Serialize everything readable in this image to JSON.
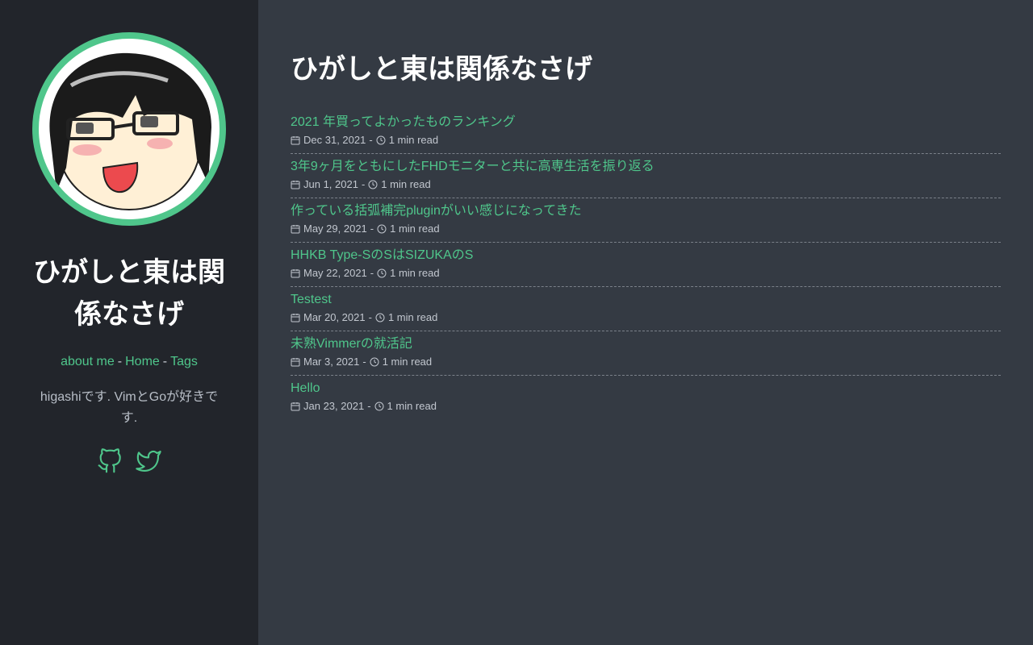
{
  "sidebar": {
    "title": "ひがしと東は関係なさげ",
    "nav": {
      "about": "about me",
      "home": "Home",
      "tags": "Tags",
      "separator": "-"
    },
    "bio": "higashiです. VimとGoが好きです.",
    "accent_color": "#4fc68b",
    "social_icons": [
      "github-icon",
      "twitter-icon"
    ]
  },
  "main": {
    "title": "ひがしと東は関係なさげ",
    "meta_separator": "-",
    "posts": [
      {
        "title": "2021 年買ってよかったものランキング",
        "date": "Dec 31, 2021",
        "read_time": "1 min read"
      },
      {
        "title": "3年9ヶ月をともにしたFHDモニターと共に高専生活を振り返る",
        "date": "Jun 1, 2021",
        "read_time": "1 min read"
      },
      {
        "title": "作っている括弧補完pluginがいい感じになってきた",
        "date": "May 29, 2021",
        "read_time": "1 min read"
      },
      {
        "title": "HHKB Type-SのSはSIZUKAのS",
        "date": "May 22, 2021",
        "read_time": "1 min read"
      },
      {
        "title": "Testest",
        "date": "Mar 20, 2021",
        "read_time": "1 min read"
      },
      {
        "title": "未熟Vimmerの就活記",
        "date": "Mar 3, 2021",
        "read_time": "1 min read"
      },
      {
        "title": "Hello",
        "date": "Jan 23, 2021",
        "read_time": "1 min read"
      }
    ]
  }
}
